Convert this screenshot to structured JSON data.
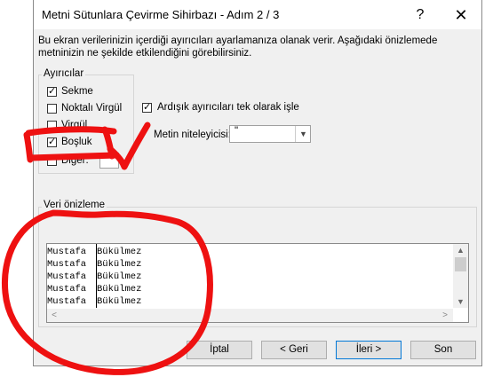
{
  "window": {
    "title": "Metni Sütunlara Çevirme Sihirbazı - Adım 2 / 3",
    "help_label": "?",
    "close_label": "✕"
  },
  "description": {
    "line1": "Bu ekran verilerinizin içerdiği ayırıcıları ayarlamanıza olanak verir. Aşağıdaki önizlemede",
    "line2": "metninizin ne şekilde etkilendiğini görebilirsiniz."
  },
  "delimiters": {
    "legend": "Ayırıcılar",
    "items": [
      {
        "label": "Sekme",
        "checked": true
      },
      {
        "label": "Noktalı Virgül",
        "checked": false
      },
      {
        "label": "Virgül",
        "checked": false
      },
      {
        "label": "Boşluk",
        "checked": true
      },
      {
        "label": "Diğer:",
        "checked": false
      }
    ],
    "other_value": ""
  },
  "consecutive": {
    "label": "Ardışık ayırıcıları tek olarak işle",
    "checked": true
  },
  "qualifier": {
    "label": "Metin niteleyicisi:",
    "value": "\""
  },
  "preview": {
    "legend": "Veri önizleme",
    "rows": [
      [
        "Mustafa",
        "Bükülmez"
      ],
      [
        "Mustafa",
        "Bükülmez"
      ],
      [
        "Mustafa",
        "Bükülmez"
      ],
      [
        "Mustafa",
        "Bükülmez"
      ],
      [
        "Mustafa",
        "Bükülmez"
      ]
    ]
  },
  "buttons": {
    "cancel": "İptal",
    "back": "< Geri",
    "next": "İleri >",
    "finish": "Son"
  },
  "icons": {
    "scroll_up": "▲",
    "scroll_down": "▼",
    "scroll_left": "<",
    "scroll_right": ">",
    "dropdown": "▼"
  },
  "annotation_color": "#ee1111"
}
